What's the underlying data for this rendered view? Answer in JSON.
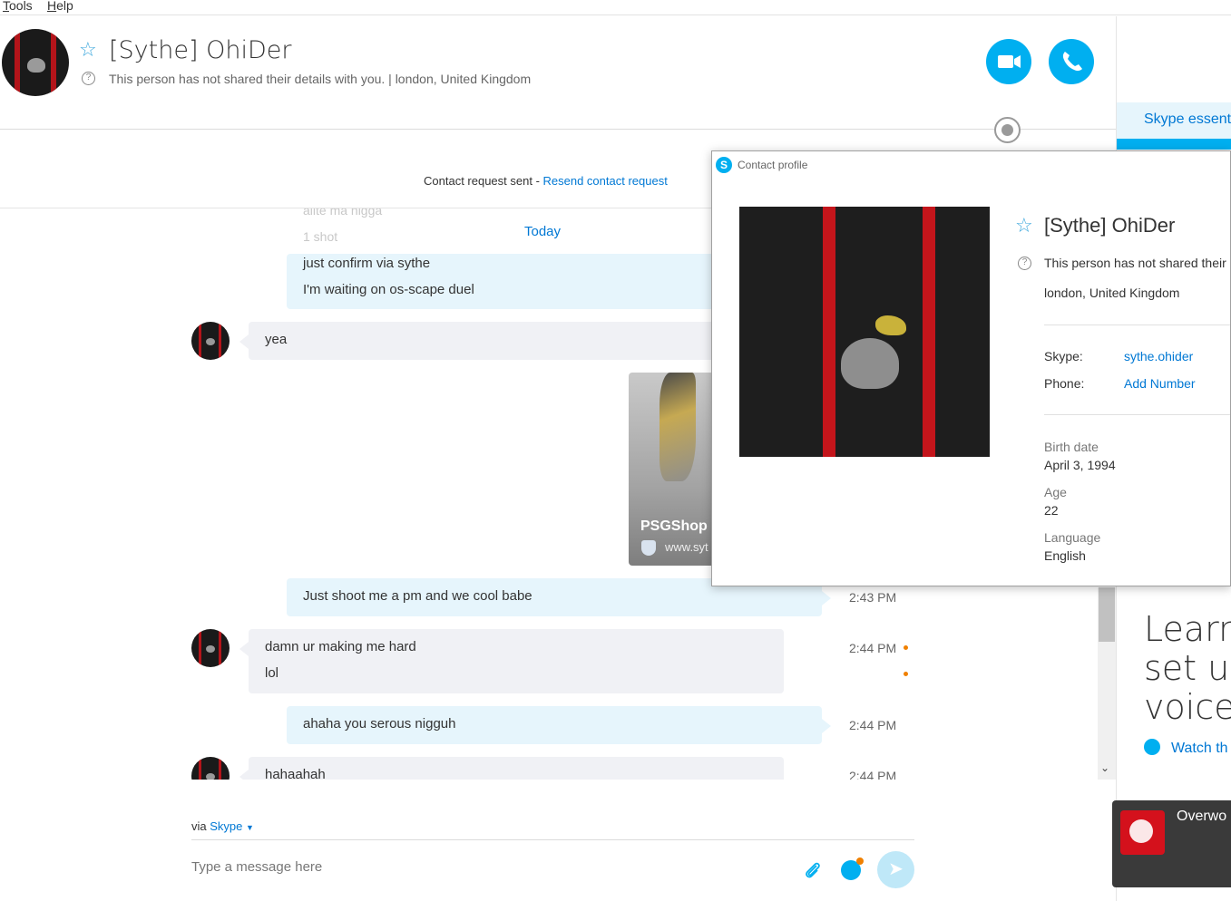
{
  "menu": {
    "tools": "Tools",
    "help": "Help"
  },
  "header": {
    "name": "[Sythe] OhiDer",
    "subtitle": "This person has not shared their details with you.  |  london, United Kingdom"
  },
  "notice": {
    "text": "Contact request sent - ",
    "link": "Resend contact request"
  },
  "chat": {
    "faded_1": "alite ma nigga",
    "faded_2": "1 shot",
    "today": "Today",
    "messages": [
      {
        "direction": "out",
        "lines": [
          "just confirm via sythe",
          "I'm waiting on os-scape duel"
        ]
      },
      {
        "direction": "in",
        "lines": [
          "yea"
        ]
      },
      {
        "direction": "out",
        "lines": [
          "Just shoot me a pm and we cool babe"
        ],
        "time": "2:43 PM"
      },
      {
        "direction": "in",
        "lines": [
          "damn ur making me hard",
          "lol"
        ],
        "time": "2:44 PM"
      },
      {
        "direction": "out",
        "lines": [
          "ahaha you serous nigguh"
        ],
        "time": "2:44 PM"
      },
      {
        "direction": "in",
        "lines": [
          "hahaahah"
        ],
        "time": "2:44 PM"
      }
    ],
    "card": {
      "title": "PSGShop",
      "url": "www.syt"
    }
  },
  "compose": {
    "via_prefix": "via",
    "via_link": "Skype",
    "placeholder": "Type a message here"
  },
  "right_panel": {
    "tab": "Skype essent",
    "learn": [
      "Learn",
      "set up",
      "voice"
    ],
    "watch": "Watch th",
    "toast_title": "Overwo"
  },
  "profile": {
    "window_title": "Contact profile",
    "name": "[Sythe] OhiDer",
    "not_shared": "This person has not shared their",
    "location": "london, United Kingdom",
    "skype_label": "Skype:",
    "skype_value": "sythe.ohider",
    "phone_label": "Phone:",
    "phone_value": "Add Number",
    "birth_label": "Birth date",
    "birth_value": "April 3, 1994",
    "age_label": "Age",
    "age_value": "22",
    "language_label": "Language",
    "language_value": "English"
  },
  "colors": {
    "accent": "#00aff0",
    "link": "#0078d4",
    "outgoing": "#e6f5fc",
    "incoming": "#f0f1f5",
    "unread": "#f08000"
  },
  "icons": [
    "star-icon",
    "help-icon",
    "video-call-icon",
    "call-icon",
    "globe-icon",
    "attach-icon",
    "emoji-icon",
    "send-icon",
    "skype-logo-icon",
    "play-icon",
    "scroll-down-icon"
  ]
}
